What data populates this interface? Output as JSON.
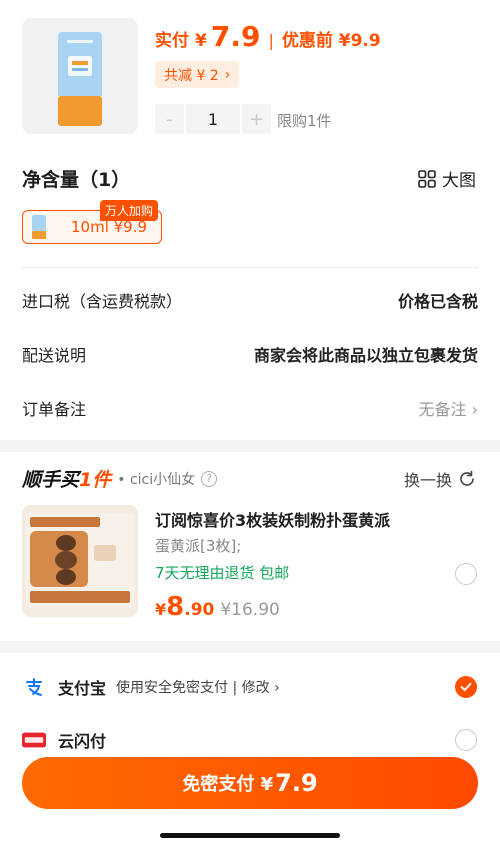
{
  "product": {
    "icon": "sunscreen-bottle-image",
    "price_label": "实付",
    "currency": "¥",
    "price": "7.9",
    "separator": "|",
    "original_price_text": "优惠前 ¥9.9",
    "discount_text": "共减 ¥ 2",
    "quantity": "1",
    "minus": "-",
    "plus": "+",
    "limit_text": "限购1件"
  },
  "spec": {
    "title": "净含量（1）",
    "bigpic_label": "大图",
    "option_text": "10ml  ¥9.9",
    "option_badge": "万人加购"
  },
  "info_rows": {
    "tax": {
      "label": "进口税（含运费税款）",
      "value": "价格已含税"
    },
    "delivery": {
      "label": "配送说明",
      "value": "商家会将此商品以独立包裹发货"
    },
    "remark": {
      "label": "订单备注",
      "value": "无备注"
    }
  },
  "addon": {
    "brand_prefix": "顺手买",
    "brand_suffix": "1件",
    "shop": "• cici小仙女",
    "help": "?",
    "swap_label": "换一换",
    "title": "订阅惊喜价3枚装妖制粉扑蛋黄派",
    "variant": "蛋黄派[3枚];",
    "service": "7天无理由退货  包邮",
    "currency": "¥",
    "price_int": "8",
    "price_dec": ".90",
    "original_price": "¥16.90"
  },
  "payment": {
    "alipay": {
      "name": "支付宝",
      "desc": "使用安全免密支付 | 修改 ›",
      "icon": "alipay-icon",
      "selected": true
    },
    "unionpay": {
      "name": "云闪付",
      "icon": "unionpay-icon",
      "selected": false
    }
  },
  "submit": {
    "label": "免密支付 ¥",
    "price": "7.9"
  },
  "colors": {
    "accent": "#ff5000",
    "green": "#13a85a",
    "alipay": "#1677ff",
    "unionpay": "#e8242b"
  }
}
